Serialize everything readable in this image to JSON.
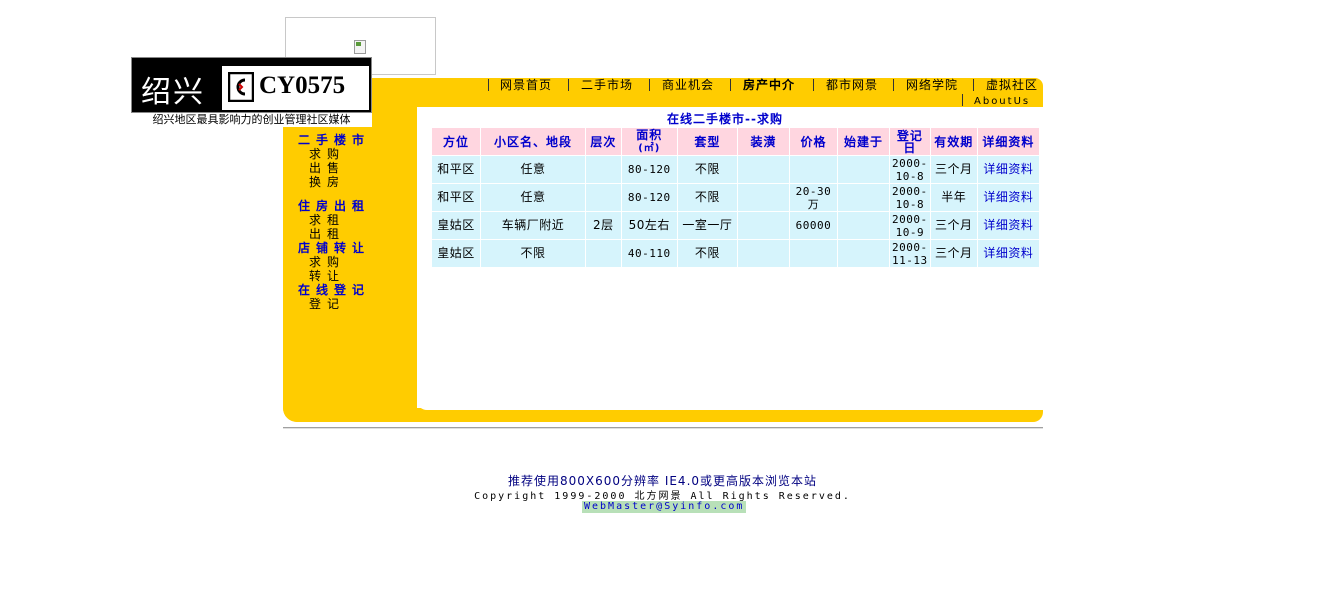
{
  "logo": {
    "city": "绍兴",
    "code": "CY0575",
    "tagline": "绍兴地区最具影响力的创业管理社区媒体"
  },
  "nav": {
    "items": [
      "网景首页",
      "二手市场",
      "商业机会",
      "房产中介",
      "都市网景",
      "网络学院",
      "虚拟社区"
    ],
    "about": "AboutUs",
    "active": "房产中介"
  },
  "sidebar": {
    "sections": [
      {
        "title": "二手楼市",
        "links": [
          "求购",
          "出售",
          "换房"
        ]
      },
      {
        "title": "住房出租",
        "links": [
          "求租",
          "出租"
        ]
      },
      {
        "title": "店铺转让",
        "links": [
          "求购",
          "转让"
        ]
      },
      {
        "title": "在线登记",
        "links": [
          "登记"
        ]
      }
    ]
  },
  "content": {
    "title": "在线二手楼市--求购",
    "headers": [
      "方位",
      "小区名、地段",
      "层次",
      "面积",
      "(㎡)",
      "套型",
      "装潢",
      "价格",
      "始建于",
      "登记",
      "日",
      "有效期",
      "详细资料"
    ],
    "rows": [
      {
        "area": "和平区",
        "location": "任意",
        "floor": "",
        "size": "80-120",
        "type": "不限",
        "decor": "",
        "price": "",
        "built": "",
        "date": "2000-10-8",
        "validity": "三个月",
        "detail": "详细资料"
      },
      {
        "area": "和平区",
        "location": "任意",
        "floor": "",
        "size": "80-120",
        "type": "不限",
        "decor": "",
        "price": "20-30万",
        "built": "",
        "date": "2000-10-8",
        "validity": "半年",
        "detail": "详细资料"
      },
      {
        "area": "皇姑区",
        "location": "车辆厂附近",
        "floor": "2层",
        "size": "50左右",
        "type": "一室一厅",
        "decor": "",
        "price": "60000",
        "built": "",
        "date": "2000-10-9",
        "validity": "三个月",
        "detail": "详细资料"
      },
      {
        "area": "皇姑区",
        "location": "不限",
        "floor": "",
        "size": "40-110",
        "type": "不限",
        "decor": "",
        "price": "",
        "built": "",
        "date": "2000-11-13",
        "validity": "三个月",
        "detail": "详细资料"
      }
    ]
  },
  "footer": {
    "recommend": "推荐使用800X600分辨率 IE4.0或更高版本浏览本站",
    "copyright": "Copyright 1999-2000 北方网景 All Rights Reserved.",
    "webmaster": "WebMaster@Syinfo.com"
  },
  "colors": {
    "frame": "#ffcc00",
    "header_cell": "#ffd6e0",
    "body_cell": "#d6f4fc",
    "link_blue": "#0000cc"
  }
}
